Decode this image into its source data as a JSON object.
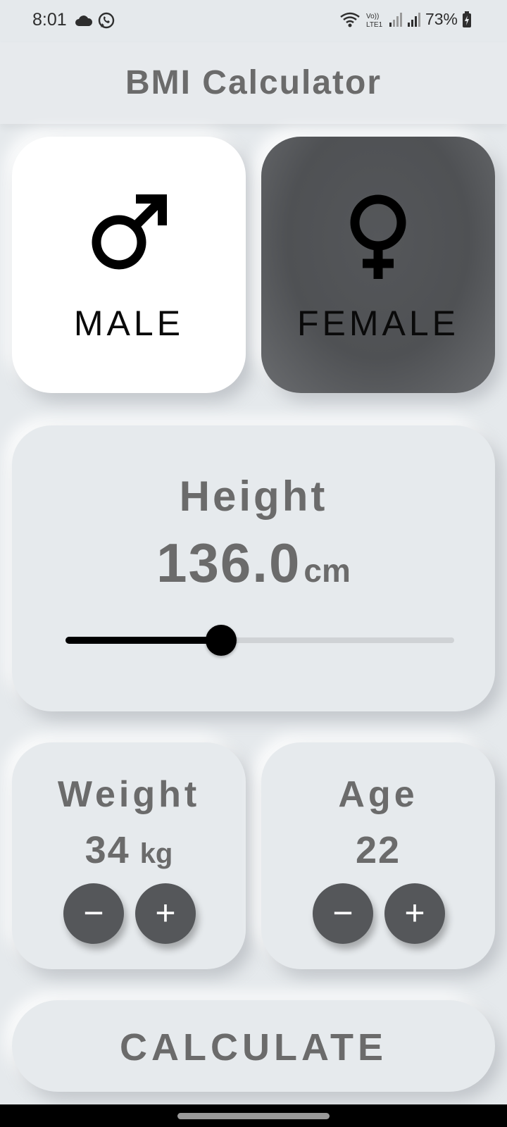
{
  "status_bar": {
    "time": "8:01",
    "left_icons": [
      "cloud-icon",
      "whatsapp-icon"
    ],
    "right_icons": [
      "wifi-icon",
      "volte-lte-icon",
      "signal-icon",
      "signal-icon",
      "battery-charging-icon"
    ],
    "volte_text": "Vo)) LTE1",
    "battery": "73%"
  },
  "app_bar": {
    "title": "BMI Calculator"
  },
  "gender": {
    "male": {
      "label": "MALE",
      "icon": "male-symbol-icon",
      "selected": true
    },
    "female": {
      "label": "FEMALE",
      "icon": "female-symbol-icon",
      "selected": false
    }
  },
  "height": {
    "label": "Height",
    "value": "136.0",
    "unit": "cm",
    "slider_fraction": 0.4
  },
  "weight": {
    "label": "Weight",
    "value": "34",
    "unit": "kg",
    "minus": "−",
    "plus": "+"
  },
  "age": {
    "label": "Age",
    "value": "22",
    "minus": "−",
    "plus": "+"
  },
  "calculate": {
    "label": "CALCULATE"
  },
  "colors": {
    "background": "#e5e9ec",
    "text_gray": "#6b6b6b",
    "dark_card": "#4f5154",
    "button_dark": "#55575a",
    "slider_active": "#000000",
    "slider_inactive": "#cfd2d5"
  }
}
